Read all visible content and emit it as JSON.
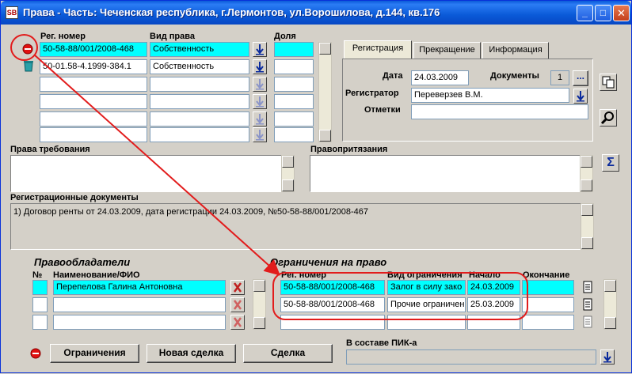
{
  "window": {
    "title": "Права - Часть: Чеченская республика, г.Лермонтов, ул.Ворошилова, д.144, кв.176",
    "minimize": "_",
    "maximize": "□",
    "close": "✕"
  },
  "rights": {
    "col_reg": "Рег. номер",
    "col_type": "Вид права",
    "col_share": "Доля",
    "rows": [
      {
        "reg": "50-58-88/001/2008-468",
        "type": "Собственность",
        "share": "",
        "selected": true
      },
      {
        "reg": "50-01.58-4.1999-384.1",
        "type": "Собственность",
        "share": "",
        "selected": false
      },
      {
        "reg": "",
        "type": "",
        "share": "",
        "selected": false
      },
      {
        "reg": "",
        "type": "",
        "share": "",
        "selected": false
      },
      {
        "reg": "",
        "type": "",
        "share": "",
        "selected": false
      },
      {
        "reg": "",
        "type": "",
        "share": "",
        "selected": false
      }
    ]
  },
  "tabs": [
    {
      "label": "Регистрация",
      "active": true
    },
    {
      "label": "Прекращение",
      "active": false
    },
    {
      "label": "Информация",
      "active": false
    }
  ],
  "registration": {
    "date_label": "Дата",
    "date_value": "24.03.2009",
    "docs_label": "Документы",
    "docs_count": "1",
    "docs_btn": "...",
    "registrar_label": "Регистратор",
    "registrar_value": "Переверзев В.М.",
    "notes_label": "Отметки",
    "notes_value": ""
  },
  "claims": {
    "claims_label": "Права требования",
    "pretensions_label": "Правопритязания",
    "sum_btn": "Σ"
  },
  "regdocs": {
    "label": "Регистрационные документы",
    "text": "1) Договор ренты от 24.03.2009, дата регистрации 24.03.2009, №50-58-88/001/2008-467"
  },
  "holders": {
    "title": "Правообладатели",
    "col_num": "№",
    "col_name": "Наименование/ФИО",
    "rows": [
      {
        "name": "Перепелова Галина Антоновна",
        "selected": true
      },
      {
        "name": "",
        "selected": false
      },
      {
        "name": "",
        "selected": false
      }
    ]
  },
  "restrictions": {
    "title": "Ограничения на право",
    "col_reg": "Рег. номер",
    "col_type": "Вид ограничения",
    "col_start": "Начало",
    "col_end": "Окончание",
    "rows": [
      {
        "reg": "50-58-88/001/2008-468",
        "type": "Залог в силу зако",
        "start": "24.03.2009",
        "end": "",
        "selected": true
      },
      {
        "reg": "50-58-88/001/2008-468",
        "type": "Прочие ограничен",
        "start": "25.03.2009",
        "end": "",
        "selected": false
      },
      {
        "reg": "",
        "type": "",
        "start": "",
        "end": "",
        "selected": false
      }
    ]
  },
  "footer": {
    "btn_restrictions": "Ограничения",
    "btn_new_deal": "Новая сделка",
    "btn_deal": "Сделка",
    "pik_label": "В составе ПИК-а",
    "pik_value": ""
  },
  "colors": {
    "selected_row": "#00ffff",
    "annotation": "#e21c1c",
    "title_bar": "#0a5ad8"
  }
}
